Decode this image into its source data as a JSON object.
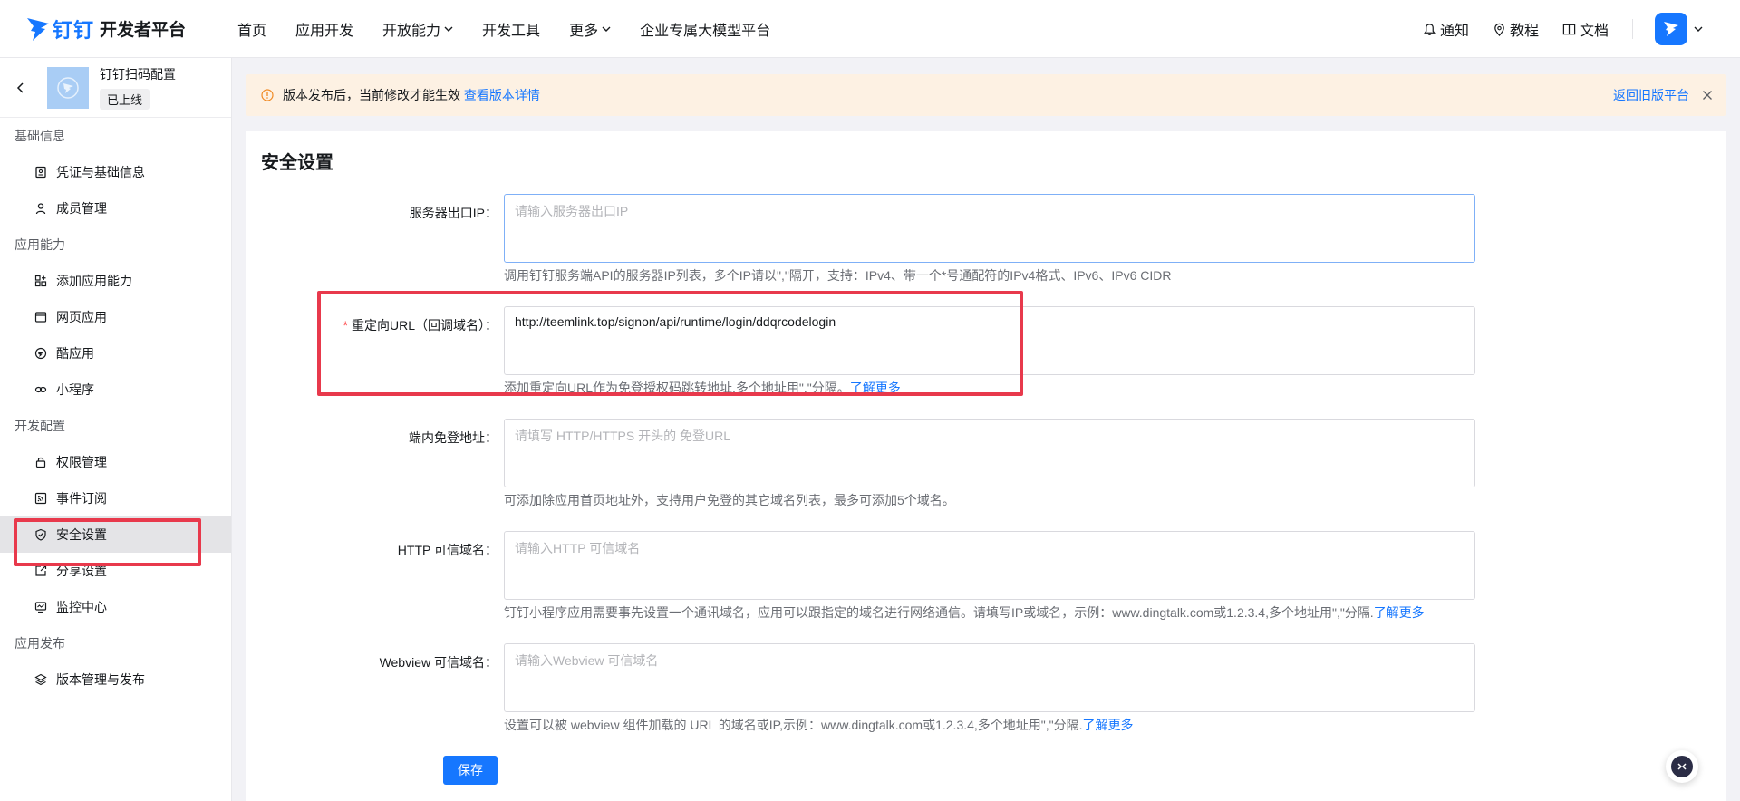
{
  "header": {
    "brand": "钉钉",
    "title": "开发者平台",
    "nav": [
      {
        "label": "首页"
      },
      {
        "label": "应用开发"
      },
      {
        "label": "开放能力"
      },
      {
        "label": "开发工具"
      },
      {
        "label": "更多"
      },
      {
        "label": "企业专属大模型平台"
      }
    ],
    "right": {
      "notify": "通知",
      "tutorial": "教程",
      "docs": "文档"
    }
  },
  "sidebar": {
    "app_name": "钉钉扫码配置",
    "app_status": "已上线",
    "sections": [
      {
        "title": "基础信息",
        "items": [
          {
            "label": "凭证与基础信息"
          },
          {
            "label": "成员管理"
          }
        ]
      },
      {
        "title": "应用能力",
        "items": [
          {
            "label": "添加应用能力"
          },
          {
            "label": "网页应用"
          },
          {
            "label": "酷应用"
          },
          {
            "label": "小程序"
          }
        ]
      },
      {
        "title": "开发配置",
        "items": [
          {
            "label": "权限管理"
          },
          {
            "label": "事件订阅"
          },
          {
            "label": "安全设置"
          },
          {
            "label": "分享设置"
          },
          {
            "label": "监控中心"
          }
        ]
      },
      {
        "title": "应用发布",
        "items": [
          {
            "label": "版本管理与发布"
          }
        ]
      }
    ],
    "active_item": "安全设置"
  },
  "banner": {
    "text": "版本发布后，当前修改才能生效",
    "link": "查看版本详情",
    "right_link": "返回旧版平台"
  },
  "form": {
    "title": "安全设置",
    "fields": [
      {
        "label": "服务器出口IP：",
        "required": false,
        "value": "",
        "placeholder": "请输入服务器出口IP",
        "hint": "调用钉钉服务端API的服务器IP列表，多个IP请以\",\"隔开，支持：IPv4、带一个*号通配符的IPv4格式、IPv6、IPv6 CIDR",
        "hint_link": ""
      },
      {
        "label": "重定向URL（回调域名）：",
        "required": true,
        "value": "http://teemlink.top/signon/api/runtime/login/ddqrcodelogin",
        "placeholder": "",
        "hint": "添加重定向URL作为免登授权码跳转地址,多个地址用\",\"分隔。",
        "hint_link": "了解更多"
      },
      {
        "label": "端内免登地址：",
        "required": false,
        "value": "",
        "placeholder": "请填写 HTTP/HTTPS 开头的 免登URL",
        "hint": "可添加除应用首页地址外，支持用户免登的其它域名列表，最多可添加5个域名。",
        "hint_link": ""
      },
      {
        "label": "HTTP 可信域名：",
        "required": false,
        "value": "",
        "placeholder": "请输入HTTP 可信域名",
        "hint": "钉钉小程序应用需要事先设置一个通讯域名，应用可以跟指定的域名进行网络通信。请填写IP或域名，示例：www.dingtalk.com或1.2.3.4,多个地址用\",\"分隔.",
        "hint_link": "了解更多"
      },
      {
        "label": "Webview 可信域名：",
        "required": false,
        "value": "",
        "placeholder": "请输入Webview 可信域名",
        "hint": "设置可以被 webview 组件加载的 URL 的域名或IP,示例：www.dingtalk.com或1.2.3.4,多个地址用\",\"分隔.",
        "hint_link": "了解更多"
      }
    ],
    "save_label": "保存"
  },
  "colors": {
    "accent": "#1677ff",
    "highlight_box": "#e8394c",
    "banner_bg": "#fdf1e3"
  }
}
